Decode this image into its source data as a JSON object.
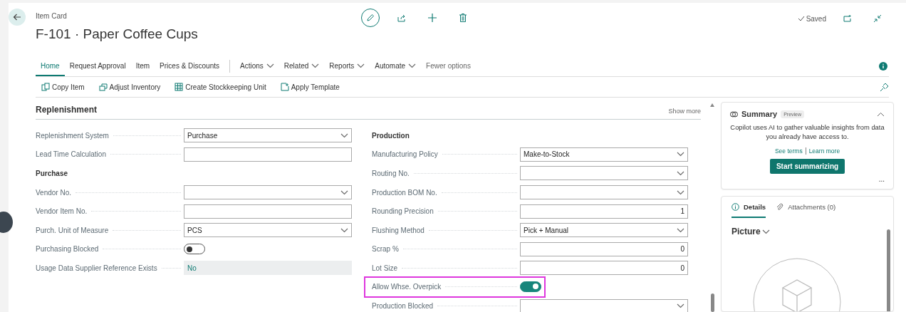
{
  "header": {
    "breadcrumb": "Item Card",
    "title": "F-101 · Paper Coffee Cups",
    "status": "Saved"
  },
  "nav": [
    {
      "kind": "tab",
      "label": "Home",
      "selected": true
    },
    {
      "kind": "tab",
      "label": "Request Approval",
      "selected": false
    },
    {
      "kind": "tab",
      "label": "Item",
      "selected": false
    },
    {
      "kind": "tab",
      "label": "Prices & Discounts",
      "selected": false
    },
    {
      "kind": "menu",
      "label": "Actions",
      "selected": false
    },
    {
      "kind": "menu",
      "label": "Related",
      "selected": false
    },
    {
      "kind": "menu",
      "label": "Reports",
      "selected": false
    },
    {
      "kind": "menu",
      "label": "Automate",
      "selected": false
    },
    {
      "kind": "link",
      "label": "Fewer options",
      "selected": false
    }
  ],
  "actions": [
    "Copy Item",
    "Adjust Inventory",
    "Create Stockkeeping Unit",
    "Apply Template"
  ],
  "section": {
    "title": "Replenishment",
    "show_more": "Show more"
  },
  "left_fields": [
    {
      "kind": "select",
      "label": "Replenishment System",
      "value": "Purchase"
    },
    {
      "kind": "text",
      "label": "Lead Time Calculation"
    },
    {
      "kind": "heading",
      "label": "Purchase"
    },
    {
      "kind": "select",
      "label": "Vendor No."
    },
    {
      "kind": "text",
      "label": "Vendor Item No."
    },
    {
      "kind": "select",
      "label": "Purch. Unit of Measure",
      "value": "PCS"
    },
    {
      "kind": "toggle",
      "label": "Purchasing Blocked",
      "on": false
    },
    {
      "kind": "readonly",
      "label": "Usage Data Supplier Reference Exists",
      "value": "No"
    }
  ],
  "right_fields": [
    {
      "kind": "heading",
      "label": "Production"
    },
    {
      "kind": "select",
      "label": "Manufacturing Policy",
      "value": "Make-to-Stock"
    },
    {
      "kind": "select",
      "label": "Routing No."
    },
    {
      "kind": "select",
      "label": "Production BOM No."
    },
    {
      "kind": "number",
      "label": "Rounding Precision",
      "value": "1"
    },
    {
      "kind": "select",
      "label": "Flushing Method",
      "value": "Pick + Manual"
    },
    {
      "kind": "number",
      "label": "Scrap %",
      "value": "0"
    },
    {
      "kind": "number",
      "label": "Lot Size",
      "value": "0"
    },
    {
      "kind": "toggle",
      "label": "Allow Whse. Overpick",
      "on": true,
      "highlighted": true
    },
    {
      "kind": "select",
      "label": "Production Blocked"
    }
  ],
  "summary": {
    "title": "Summary",
    "badge": "Preview",
    "text": "Copilot uses AI to gather valuable insights from data you already have access to.",
    "links": [
      "See terms",
      "Learn more"
    ],
    "button": "Start summarizing",
    "more": "..."
  },
  "details": {
    "tabs": [
      {
        "label": "Details",
        "selected": true
      },
      {
        "label": "Attachments (0)",
        "selected": false
      }
    ],
    "picture_heading": "Picture"
  }
}
